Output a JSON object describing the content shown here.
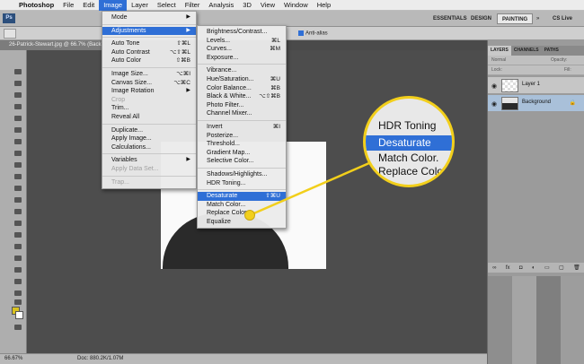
{
  "menubar": {
    "apple": "",
    "app": "Photoshop",
    "items": [
      "File",
      "Edit",
      "Image",
      "Layer",
      "Select",
      "Filter",
      "Analysis",
      "3D",
      "View",
      "Window",
      "Help"
    ]
  },
  "appbar": {
    "ps": "Ps",
    "workspaces": [
      "ESSENTIALS",
      "DESIGN",
      "PAINTING"
    ],
    "cslive": "CS Live"
  },
  "optbar": {
    "antialias": "Anti-alias"
  },
  "doc": {
    "tab": "26-Patrick-Stewart.jpg @ 66.7% (Back...",
    "zoom": "66.67%",
    "docsize": "Doc: 880.2K/1.07M"
  },
  "image_menu": [
    {
      "label": "Mode",
      "sub": true
    },
    {
      "sep": true
    },
    {
      "label": "Adjustments",
      "sub": true,
      "highlight": true
    },
    {
      "sep": true
    },
    {
      "label": "Auto Tone",
      "sc": "⇧⌘L"
    },
    {
      "label": "Auto Contrast",
      "sc": "⌥⇧⌘L"
    },
    {
      "label": "Auto Color",
      "sc": "⇧⌘B"
    },
    {
      "sep": true
    },
    {
      "label": "Image Size...",
      "sc": "⌥⌘I"
    },
    {
      "label": "Canvas Size...",
      "sc": "⌥⌘C"
    },
    {
      "label": "Image Rotation",
      "sub": true
    },
    {
      "label": "Crop",
      "dis": true
    },
    {
      "label": "Trim..."
    },
    {
      "label": "Reveal All"
    },
    {
      "sep": true
    },
    {
      "label": "Duplicate..."
    },
    {
      "label": "Apply Image..."
    },
    {
      "label": "Calculations..."
    },
    {
      "sep": true
    },
    {
      "label": "Variables",
      "sub": true
    },
    {
      "label": "Apply Data Set...",
      "dis": true
    },
    {
      "sep": true
    },
    {
      "label": "Trap...",
      "dis": true
    }
  ],
  "adjust_menu": [
    {
      "label": "Brightness/Contrast..."
    },
    {
      "label": "Levels...",
      "sc": "⌘L"
    },
    {
      "label": "Curves...",
      "sc": "⌘M"
    },
    {
      "label": "Exposure..."
    },
    {
      "sep": true
    },
    {
      "label": "Vibrance..."
    },
    {
      "label": "Hue/Saturation...",
      "sc": "⌘U"
    },
    {
      "label": "Color Balance...",
      "sc": "⌘B"
    },
    {
      "label": "Black & White...",
      "sc": "⌥⇧⌘B"
    },
    {
      "label": "Photo Filter..."
    },
    {
      "label": "Channel Mixer..."
    },
    {
      "sep": true
    },
    {
      "label": "Invert",
      "sc": "⌘I"
    },
    {
      "label": "Posterize..."
    },
    {
      "label": "Threshold..."
    },
    {
      "label": "Gradient Map..."
    },
    {
      "label": "Selective Color..."
    },
    {
      "sep": true
    },
    {
      "label": "Shadows/Highlights..."
    },
    {
      "label": "HDR Toning..."
    },
    {
      "sep": true
    },
    {
      "label": "Desaturate",
      "sc": "⇧⌘U",
      "highlight": true
    },
    {
      "label": "Match Color..."
    },
    {
      "label": "Replace Color..."
    },
    {
      "label": "Equalize"
    }
  ],
  "magnifier": [
    "HDR Toning",
    "Desaturate",
    "Match Color.",
    "Replace Colo"
  ],
  "layers_panel": {
    "tabs": [
      "LAYERS",
      "CHANNELS",
      "PATHS"
    ],
    "blend": "Normal",
    "opacity": "Opacity:",
    "lock": "Lock:",
    "fill": "Fill:",
    "layers": [
      {
        "name": "Layer 1",
        "selected": false
      },
      {
        "name": "Background",
        "selected": true,
        "lock": "🔒"
      }
    ]
  },
  "colors": {
    "accent": "#2f6fd6",
    "callout": "#f2cf1b",
    "foreground_swatch": "#d9c21e"
  }
}
